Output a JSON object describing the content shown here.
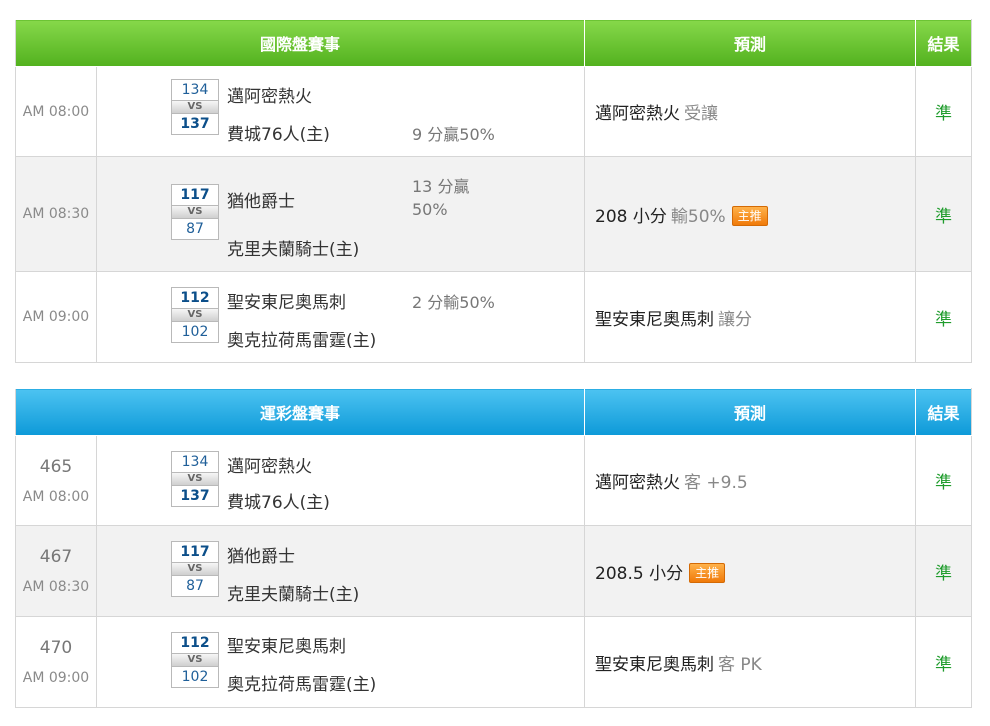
{
  "international": {
    "header": {
      "title": "國際盤賽事",
      "prediction": "預測",
      "result": "結果"
    },
    "rows": [
      {
        "time": "AM 08:00",
        "score1": "134",
        "score2": "137",
        "team1": "邁阿密熱火",
        "team2": "費城76人(主)",
        "line": "9 分贏50%",
        "pick": "邁阿密熱火",
        "pick_sub": "受讓",
        "badge": "",
        "result": "準"
      },
      {
        "time": "AM 08:30",
        "score1": "117",
        "score2": "87",
        "team1": "猶他爵士",
        "team2": "克里夫蘭騎士(主)",
        "line_a": "13 分贏",
        "line_b": "50%",
        "pick": "208 小分",
        "pick_sub": "輸50%",
        "badge": "主推",
        "result": "準"
      },
      {
        "time": "AM 09:00",
        "score1": "112",
        "score2": "102",
        "team1": "聖安東尼奧馬刺",
        "team2": "奧克拉荷馬雷霆(主)",
        "line": "2 分輸50%",
        "pick": "聖安東尼奧馬刺",
        "pick_sub": "讓分",
        "badge": "",
        "result": "準"
      }
    ]
  },
  "sports_lottery": {
    "header": {
      "title": "運彩盤賽事",
      "prediction": "預測",
      "result": "結果"
    },
    "rows": [
      {
        "id": "465",
        "time": "AM 08:00",
        "score1": "134",
        "score2": "137",
        "team1": "邁阿密熱火",
        "team2": "費城76人(主)",
        "pick": "邁阿密熱火",
        "pick_sub": "客 +9.5",
        "badge": "",
        "result": "準"
      },
      {
        "id": "467",
        "time": "AM 08:30",
        "score1": "117",
        "score2": "87",
        "team1": "猶他爵士",
        "team2": "克里夫蘭騎士(主)",
        "pick": "208.5 小分",
        "pick_sub": "",
        "badge": "主推",
        "result": "準"
      },
      {
        "id": "470",
        "time": "AM 09:00",
        "score1": "112",
        "score2": "102",
        "team1": "聖安東尼奧馬刺",
        "team2": "奧克拉荷馬雷霆(主)",
        "pick": "聖安東尼奧馬刺",
        "pick_sub": "客 PK",
        "badge": "",
        "result": "準"
      }
    ]
  },
  "vs_label": "VS",
  "colors": {
    "green_header": "#6cc634",
    "blue_header": "#24aee5",
    "result_green": "#1f9c2c",
    "badge_orange": "#f5901f"
  }
}
